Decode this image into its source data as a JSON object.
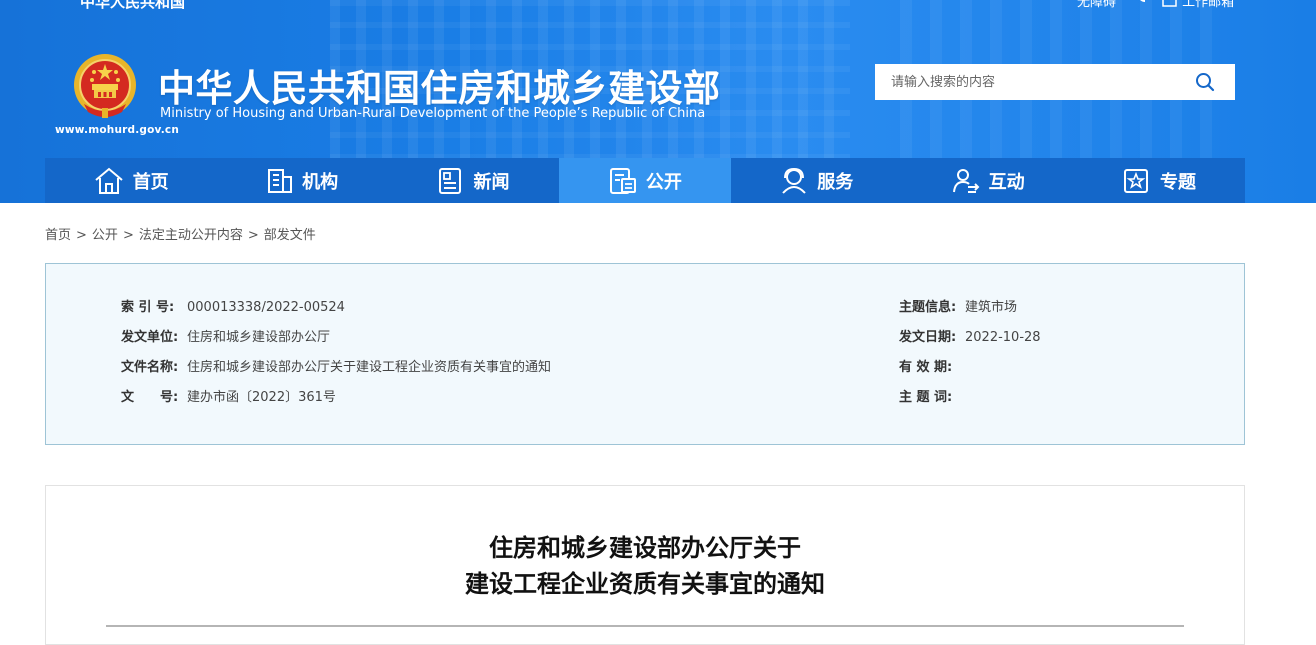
{
  "header": {
    "top_left_partial": "中华人民共和国",
    "top_links": [
      "无障碍",
      "",
      "工作邮箱"
    ],
    "title_cn": "中华人民共和国住房和城乡建设部",
    "title_en": "Ministry of Housing and Urban-Rural Development of the People’s Republic of China",
    "site_url": "www.mohurd.gov.cn"
  },
  "search": {
    "placeholder": "请输入搜索的内容",
    "icon": "search-icon"
  },
  "nav": {
    "items": [
      {
        "label": "首页",
        "icon": "home-icon"
      },
      {
        "label": "机构",
        "icon": "building-icon"
      },
      {
        "label": "新闻",
        "icon": "news-icon"
      },
      {
        "label": "公开",
        "icon": "document-icon"
      },
      {
        "label": "服务",
        "icon": "service-icon"
      },
      {
        "label": "互动",
        "icon": "interaction-icon"
      },
      {
        "label": "专题",
        "icon": "star-topic-icon"
      }
    ],
    "active": "公开",
    "active_color": "#3595f0",
    "bar_color": "#1467c9"
  },
  "breadcrumb": [
    "首页",
    "公开",
    "法定主动公开内容",
    "部发文件"
  ],
  "info": {
    "index_label": "索 引 号:",
    "index_value": "000013338/2022-00524",
    "issuer_label": "发文单位:",
    "issuer_value": "住房和城乡建设部办公厅",
    "docname_label": "文件名称:",
    "docname_value": "住房和城乡建设部办公厅关于建设工程企业资质有关事宜的通知",
    "docnum_label": "文　　号:",
    "docnum_value": "建办市函〔2022〕361号",
    "topic_label": "主题信息:",
    "topic_value": "建筑市场",
    "date_label": "发文日期:",
    "date_value": "2022-10-28",
    "validity_label": "有 效 期:",
    "validity_value": "",
    "keywords_label": "主 题 词:",
    "keywords_value": ""
  },
  "article": {
    "title_line1": "住房和城乡建设部办公厅关于",
    "title_line2": "建设工程企业资质有关事宜的通知"
  }
}
